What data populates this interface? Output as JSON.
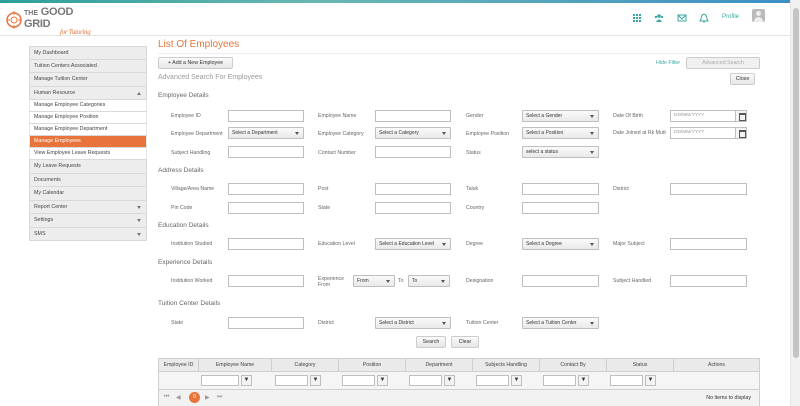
{
  "brand": {
    "line1": "THE",
    "line2": "GOOD",
    "line3": "GRID",
    "tagline": "for Tutoring",
    "accent": "#e8743b",
    "teal": "#3aa7a3"
  },
  "header": {
    "icons": [
      "grid-icon",
      "users-icon",
      "mail-icon",
      "bell-icon"
    ],
    "profile_label": "Profile"
  },
  "sidebar": {
    "items": [
      {
        "label": "My Dashboard"
      },
      {
        "label": "Tuition Centers Associated"
      },
      {
        "label": "Manage Tuition Center"
      },
      {
        "label": "Human Resource"
      },
      {
        "label": "Manage Employee Categories"
      },
      {
        "label": "Manage Employee Position"
      },
      {
        "label": "Manage Employee Department"
      },
      {
        "label": "Manage Employees"
      },
      {
        "label": "View Employee Leave Requests"
      },
      {
        "label": "My Leave Requests"
      },
      {
        "label": "Documents"
      },
      {
        "label": "My Calendar"
      },
      {
        "label": "Report Center"
      },
      {
        "label": "Settings"
      },
      {
        "label": "SMS"
      }
    ]
  },
  "main": {
    "title": "List Of Employees",
    "add_button": "+ Add a New Employee",
    "hide_filter": "Hide Filter",
    "advanced_search_button": "Advanced Search",
    "advanced_title": "Advanced Search For Employees",
    "close_button": "Close",
    "search_button": "Search",
    "clear_button": "Clear"
  },
  "sections": {
    "employee": "Employee Details",
    "address": "Address Details",
    "education": "Education Details",
    "experience": "Experience Details",
    "tuition": "Tuition Center Details"
  },
  "fields": {
    "employee_id": "Employee ID",
    "employee_name": "Employee Name",
    "gender": "Gender",
    "gender_value": "Select a Gender",
    "dob": "Date Of Birth",
    "date_placeholder": "DD/MM/YYYY",
    "department": "Employee Department",
    "department_value": "Select a Department",
    "category": "Employee Category",
    "category_value": "Select a Category",
    "position": "Employee Position",
    "position_value": "Select a Position",
    "joined": "Date Joined at Rk Mutt",
    "subject_handling": "Subject Handling",
    "contact_number": "Contact Number",
    "status": "Status",
    "status_value": "select a status",
    "village": "Village/Area Name",
    "post": "Post",
    "taluk": "Taluk",
    "district": "District",
    "pincode": "Pin Code",
    "state": "State",
    "country": "Country",
    "institution_studied": "Institution Studied",
    "education_level": "Education Level",
    "education_level_value": "Select a Education Level",
    "degree": "Degree",
    "degree_value": "Select a Degree",
    "major_subject": "Major Subject",
    "institution_worked": "Institution Worked",
    "experience_from_1": "Experience",
    "experience_from_2": "From",
    "from_value": "From",
    "to_label": "To",
    "to_value": "To",
    "designation": "Designation",
    "subject_handled": "Subject Handled",
    "tc_state": "State",
    "tc_district": "District",
    "tc_district_value": "Select a District",
    "tuition_center": "Tuition Center",
    "tuition_center_value": "Select a Tuition Center"
  },
  "grid": {
    "columns": [
      "Employee ID",
      "Employee Name",
      "Category",
      "Position",
      "Department",
      "Subjects Handling",
      "Contact By",
      "Status",
      "Actions"
    ],
    "filter_icon": "filter-icon",
    "pager": {
      "current_page": "0",
      "first": "⏮",
      "prev": "◀",
      "next": "▶",
      "last": "⏭"
    },
    "empty_message": "No items to display"
  }
}
